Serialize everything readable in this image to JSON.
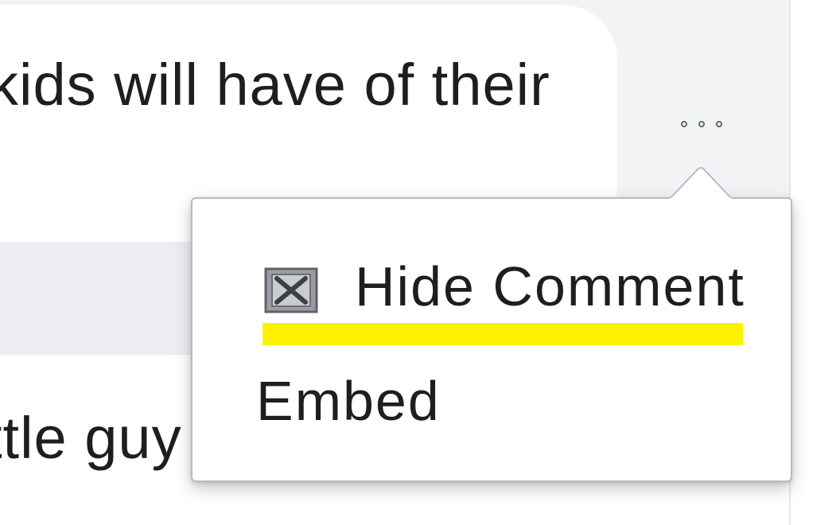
{
  "comments": {
    "top_text": "kids will have of their",
    "bottom_text": "ttle guy"
  },
  "more_options": {
    "icon": "more-horizontal-icon"
  },
  "menu": {
    "items": [
      {
        "label": "Hide Comment",
        "icon": "hide-comment-icon",
        "highlighted": true
      },
      {
        "label": "Embed"
      }
    ],
    "highlight_color": "#fff200"
  }
}
